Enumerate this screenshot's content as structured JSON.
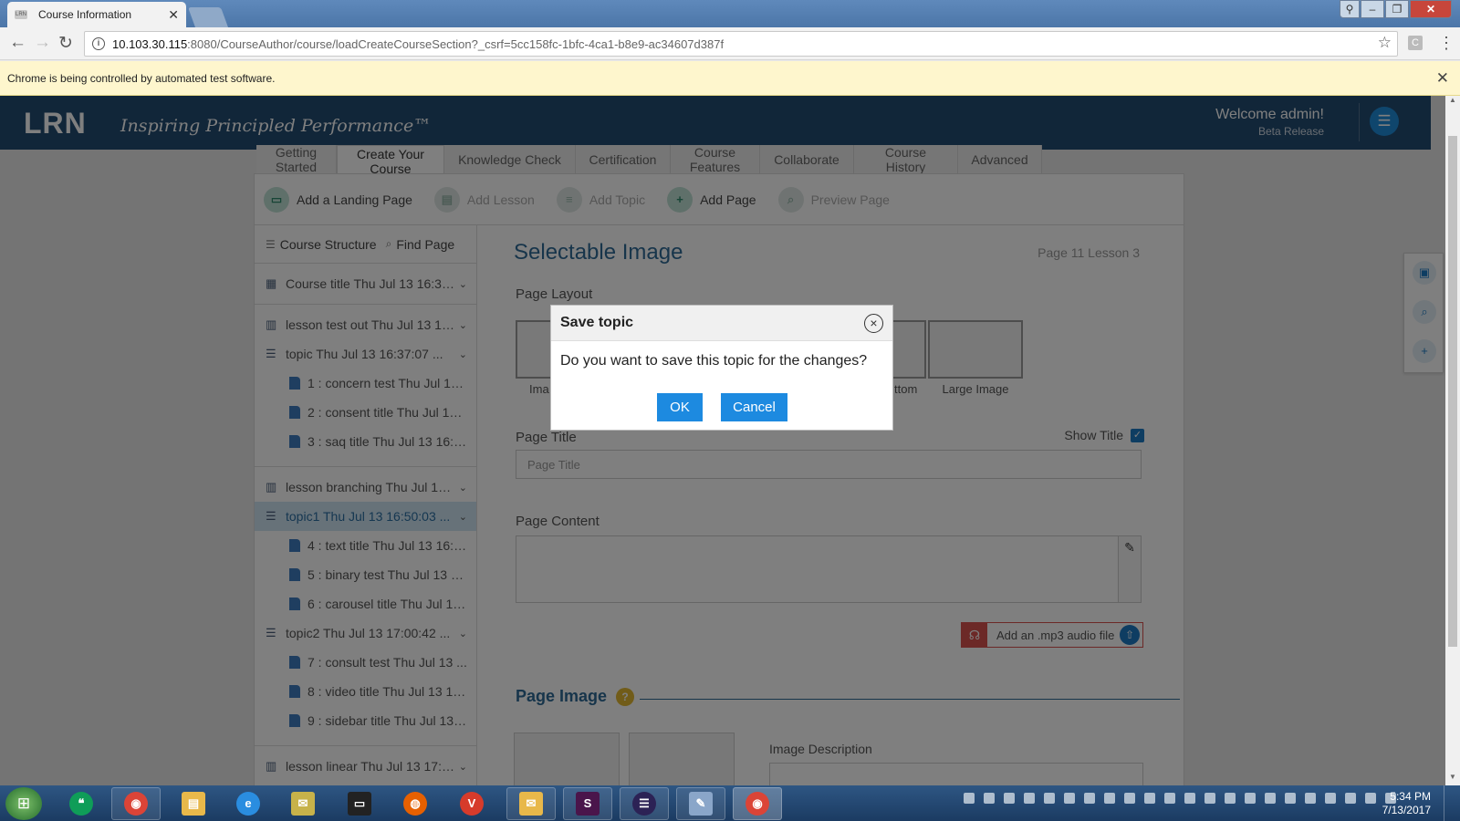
{
  "browser": {
    "tab_title": "Course Information",
    "tab_close": "✕",
    "url_host": "10.103.30.115",
    "url_rest": ":8080/CourseAuthor/course/loadCreateCourseSection?_csrf=5cc158fc-1bfc-4ca1-b8e9-ac34607d387f",
    "infobar_text": "Chrome is being controlled by automated test software.",
    "infobar_close": "✕"
  },
  "header": {
    "logo": "LRN",
    "tagline": "Inspiring Principled Performance™",
    "welcome": "Welcome admin!",
    "release": "Beta Release"
  },
  "course_tabs": [
    {
      "label": "Getting\nStarted"
    },
    {
      "label": "Create Your\nCourse"
    },
    {
      "label": "Knowledge Check"
    },
    {
      "label": "Certification"
    },
    {
      "label": "Course\nFeatures"
    },
    {
      "label": "Collaborate"
    },
    {
      "label": "Course History"
    },
    {
      "label": "Advanced"
    }
  ],
  "actions": {
    "add_landing": "Add a Landing Page",
    "add_lesson": "Add Lesson",
    "add_topic": "Add Topic",
    "add_page": "Add Page",
    "preview_page": "Preview Page"
  },
  "sidebar": {
    "course_structure": "Course Structure",
    "find_page": "Find Page",
    "course_title": "Course title Thu Jul 13 16:36:...",
    "items": [
      {
        "label": "lesson test out Thu Jul 13 16..."
      },
      {
        "label": "topic Thu Jul 13 16:37:07 ..."
      },
      {
        "label": "1 : concern test Thu Jul 13 ..."
      },
      {
        "label": "2 : consent title Thu Jul 13 ..."
      },
      {
        "label": "3 : saq title Thu Jul 13 16:4..."
      },
      {
        "label": "lesson branching Thu Jul 13 ..."
      },
      {
        "label": "topic1 Thu Jul 13 16:50:03 ..."
      },
      {
        "label": "4 : text title Thu Jul 13 16:5..."
      },
      {
        "label": "5 : binary test Thu Jul 13 1..."
      },
      {
        "label": "6 : carousel title Thu Jul 13..."
      },
      {
        "label": "topic2 Thu Jul 13 17:00:42 ..."
      },
      {
        "label": "7 : consult test Thu Jul 13 ..."
      },
      {
        "label": "8 : video title Thu Jul 13 17..."
      },
      {
        "label": "9 : sidebar title Thu Jul 13 ..."
      },
      {
        "label": "lesson linear Thu Jul 13 17:1..."
      }
    ]
  },
  "main": {
    "heading": "Selectable Image",
    "position": "Page 11  Lesson 3",
    "layout_label": "Page Layout",
    "layout_captions": [
      "Ima",
      "ttom",
      "Large Image"
    ],
    "page_title_label": "Page Title",
    "show_title": "Show Title",
    "page_title_placeholder": "Page Title",
    "page_content_label": "Page Content",
    "mp3_label": "Add an .mp3 audio file",
    "page_image_heading": "Page Image",
    "help_mark": "?",
    "image_description_label": "Image Description"
  },
  "modal": {
    "title": "Save topic",
    "message": "Do you want to save this topic for the changes?",
    "ok": "OK",
    "cancel": "Cancel"
  },
  "taskbar": {
    "time": "5:34 PM",
    "date": "7/13/2017"
  }
}
